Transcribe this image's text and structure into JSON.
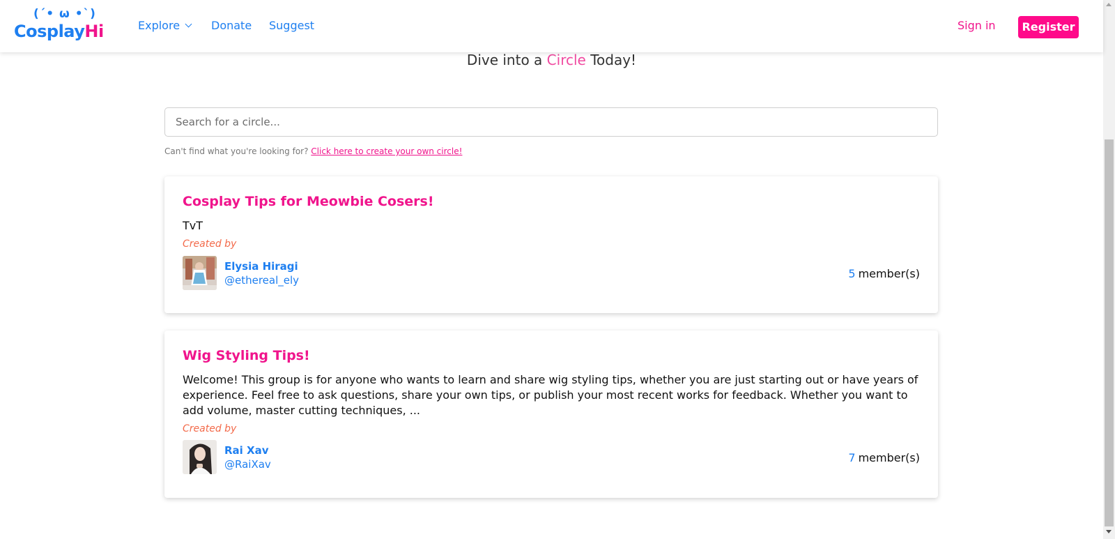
{
  "brand": {
    "face": "(´• ω •`)",
    "name_part1": "Cosplay",
    "name_part2": "Hi"
  },
  "nav": {
    "explore": "Explore",
    "donate": "Donate",
    "suggest": "Suggest"
  },
  "auth": {
    "signin": "Sign in",
    "register": "Register"
  },
  "hero": {
    "prefix": "Dive into a ",
    "accent": "Circle",
    "suffix": " Today!"
  },
  "search": {
    "placeholder": "Search for a circle..."
  },
  "hint": {
    "text": "Can't find what you're looking for? ",
    "link": "Click here to create your own circle!"
  },
  "circles": [
    {
      "title": "Cosplay Tips for Meowbie Cosers!",
      "description": "TvT",
      "created_by_label": "Created by",
      "creator_name": "Elysia Hiragi",
      "creator_handle": "@ethereal_ely",
      "member_count": "5",
      "member_label": "member(s)"
    },
    {
      "title": "Wig Styling Tips!",
      "description": "Welcome! This group is for anyone who wants to learn and share wig styling tips, whether you are just starting out or have years of experience. Feel free to ask questions, share your own tips, or publish your most recent works for feedback. Whether you want to add volume, master cutting techniques, ...",
      "created_by_label": "Created by",
      "creator_name": "Rai Xav",
      "creator_handle": "@RaiXav",
      "member_count": "7",
      "member_label": "member(s)"
    }
  ],
  "colors": {
    "brand_blue": "#1e7ff0",
    "brand_pink": "#f0148c",
    "created_by": "#f36a4a"
  }
}
